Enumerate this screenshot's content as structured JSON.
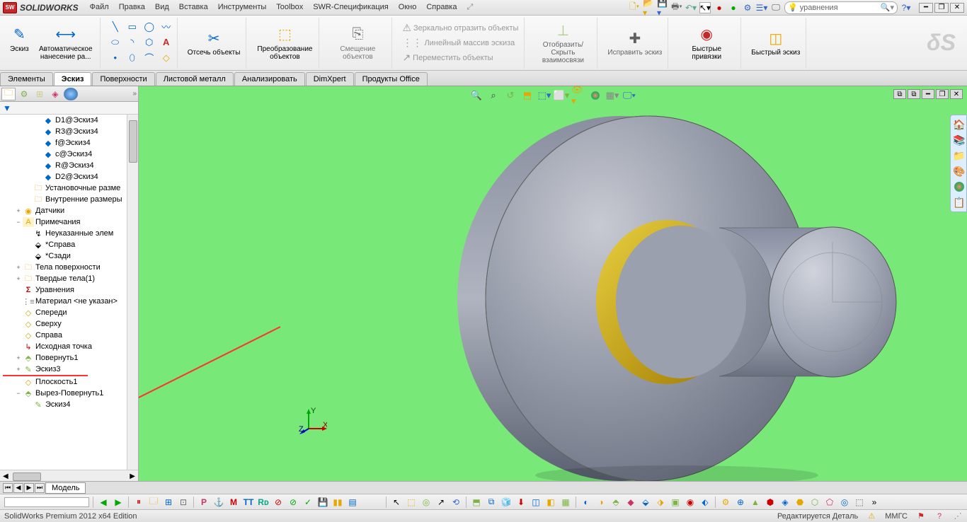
{
  "titlebar": {
    "brand": "SOLIDWORKS",
    "menus": [
      "Файл",
      "Правка",
      "Вид",
      "Вставка",
      "Инструменты",
      "Toolbox",
      "SWR-Спецификация",
      "Окно",
      "Справка"
    ],
    "search": "уравнения"
  },
  "ribbon": {
    "sketch": "Эскиз",
    "autodim": "Автоматическое нанесение ра...",
    "trim": "Отсечь объекты",
    "convert": "Преобразование объектов",
    "offset": "Смещение объектов",
    "mirror": "Зеркально отразить объекты",
    "linear": "Линейный массив эскиза",
    "move": "Переместить объекты",
    "showrel": "Отобразить/Скрыть взаимосвязи",
    "repair": "Исправить эскиз",
    "snaps": "Быстрые привязки",
    "quicksketch": "Быстрый эскиз"
  },
  "tabs": [
    "Элементы",
    "Эскиз",
    "Поверхности",
    "Листовой металл",
    "Анализировать",
    "DimXpert",
    "Продукты Office"
  ],
  "active_tab": 1,
  "tree": {
    "items": [
      {
        "lvl": 3,
        "ico": "dim",
        "label": "D1@Эскиз4"
      },
      {
        "lvl": 3,
        "ico": "dim",
        "label": "R3@Эскиз4"
      },
      {
        "lvl": 3,
        "ico": "dim",
        "label": "f@Эскиз4"
      },
      {
        "lvl": 3,
        "ico": "dim",
        "label": "c@Эскиз4"
      },
      {
        "lvl": 3,
        "ico": "dim",
        "label": "R@Эскиз4"
      },
      {
        "lvl": 3,
        "ico": "dim",
        "label": "D2@Эскиз4"
      },
      {
        "lvl": 2,
        "ico": "folder",
        "label": "Установочные разме"
      },
      {
        "lvl": 2,
        "ico": "folder",
        "label": "Внутренние размеры"
      },
      {
        "lvl": 1,
        "ico": "sensor",
        "label": "Датчики",
        "exp": "+"
      },
      {
        "lvl": 1,
        "ico": "note",
        "label": "Примечания",
        "exp": "−"
      },
      {
        "lvl": 2,
        "ico": "hide",
        "label": "Неуказанные элем"
      },
      {
        "lvl": 2,
        "ico": "view",
        "label": "*Справа"
      },
      {
        "lvl": 2,
        "ico": "view",
        "label": "*Сзади"
      },
      {
        "lvl": 1,
        "ico": "folder",
        "label": "Тела поверхности",
        "exp": "+"
      },
      {
        "lvl": 1,
        "ico": "folder",
        "label": "Твердые тела(1)",
        "exp": "+"
      },
      {
        "lvl": 1,
        "ico": "eq",
        "label": "Уравнения"
      },
      {
        "lvl": 1,
        "ico": "mat",
        "label": "Материал <не указан>"
      },
      {
        "lvl": 1,
        "ico": "plane",
        "label": "Спереди"
      },
      {
        "lvl": 1,
        "ico": "plane",
        "label": "Сверху"
      },
      {
        "lvl": 1,
        "ico": "plane",
        "label": "Справа"
      },
      {
        "lvl": 1,
        "ico": "origin",
        "label": "Исходная точка"
      },
      {
        "lvl": 1,
        "ico": "feat",
        "label": "Повернуть1",
        "exp": "+"
      },
      {
        "lvl": 1,
        "ico": "sketch",
        "label": "Эскиз3",
        "exp": "+"
      },
      {
        "lvl": 1,
        "ico": "plane",
        "label": "Плоскость1"
      },
      {
        "lvl": 1,
        "ico": "feat",
        "label": "Вырез-Повернуть1",
        "exp": "−"
      },
      {
        "lvl": 2,
        "ico": "sketch",
        "label": "Эскиз4"
      }
    ]
  },
  "bottom_tab": "Модель",
  "status": {
    "left": "SolidWorks Premium 2012 x64 Edition",
    "editing": "Редактируется Деталь",
    "units": "ММГС"
  },
  "triad": {
    "x": "X",
    "y": "Y",
    "z": "Z"
  }
}
